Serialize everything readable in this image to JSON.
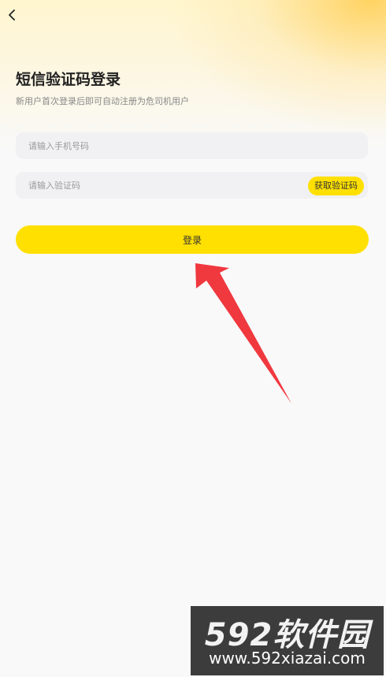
{
  "header": {
    "back_icon": "chevron-left-icon"
  },
  "login": {
    "title": "短信验证码登录",
    "subtitle": "新用户首次登录后即可自动注册为危司机用户",
    "phone_placeholder": "请输入手机号码",
    "phone_value": "",
    "code_placeholder": "请输入验证码",
    "code_value": "",
    "get_code_label": "获取验证码",
    "submit_label": "登录"
  },
  "annotation": {
    "arrow_color": "#f0383f"
  },
  "watermark": {
    "brand": "592软件园",
    "url": "www.592xiazai.com"
  },
  "colors": {
    "accent": "#ffe000",
    "background": "#f9f9f9",
    "field_bg": "#f1f1f3"
  }
}
